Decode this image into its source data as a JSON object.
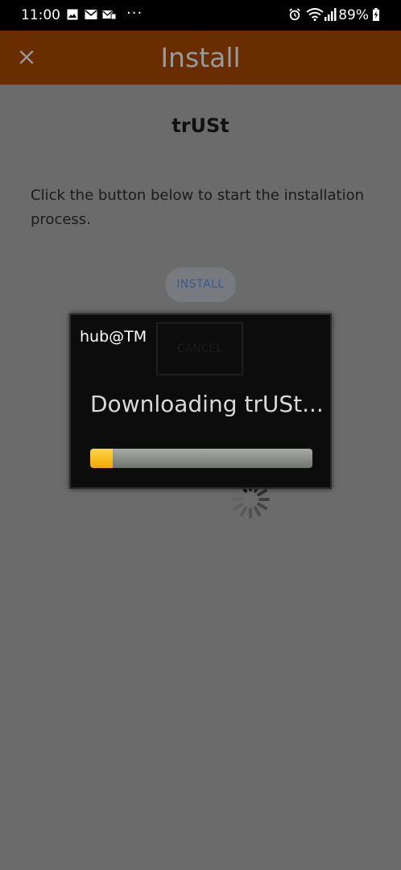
{
  "status_bar": {
    "time": "11:00",
    "left_icons": [
      "image-icon",
      "email-icon",
      "notification-icon",
      "more-dots-icon"
    ],
    "more": "···",
    "right_icons": [
      "alarm-icon",
      "wifi-icon",
      "signal-icon"
    ],
    "battery": "89%"
  },
  "app_bar": {
    "title": "Install",
    "close_icon": "close-icon",
    "background": "#6a2d00"
  },
  "content": {
    "app_name": "trUSt",
    "instructions": "Click the button below to start the installation process.",
    "install_label": "INSTALL",
    "cancel_label": "CANCEL"
  },
  "dialog": {
    "title": "hub@TM",
    "message": "Downloading trUSt...",
    "progress": 0.1,
    "progress_color": "#f5b400"
  }
}
